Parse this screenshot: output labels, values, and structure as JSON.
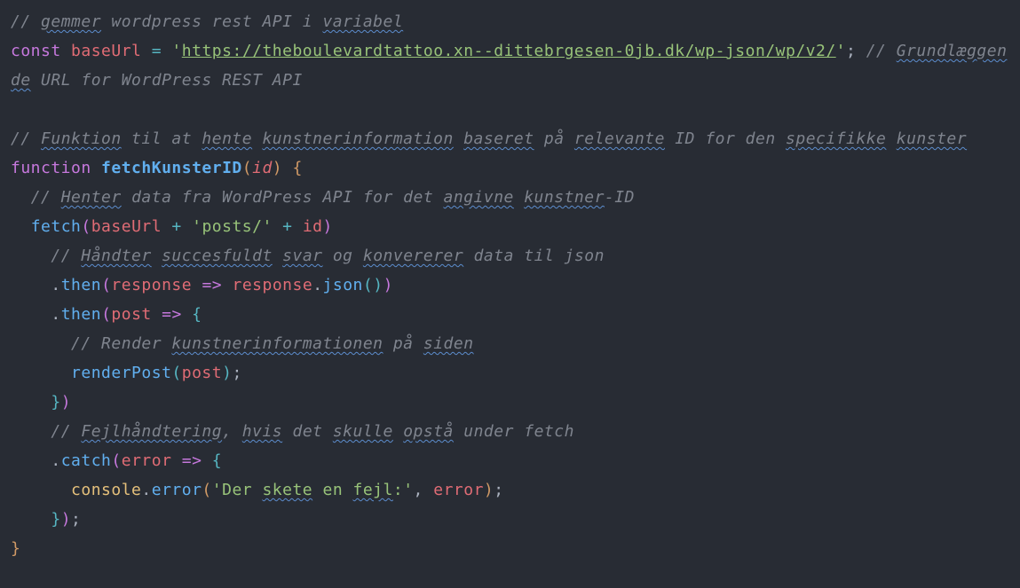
{
  "code": {
    "c1_gemmer": "gemmer",
    "c1_rest": " wordpress rest API i ",
    "c1_variabel": "variabel",
    "kw_const": "const",
    "var_baseUrl": "baseUrl",
    "op_eq": "=",
    "str_q1": "'",
    "url_text": "https://theboulevardtattoo.xn--dittebrgesen-0jb.dk/wp-json/wp/v2/",
    "str_q2": "'",
    "semi": ";",
    "c2_grund": "Grundlæggende",
    "c2_rest": " URL for WordPress REST API",
    "c3_funktion": "Funktion",
    "c3_til": " til at ",
    "c3_hente": "hente",
    "c3_sp": " ",
    "c3_kunst": "kunstnerinformation",
    "c3_sp2": " ",
    "c3_baseret": "baseret",
    "c3_pa": " på ",
    "c3_relevante": "relevante",
    "c3_idfor": " ID for den ",
    "c3_specifikke": "specifikke",
    "c3_sp3": " ",
    "c3_kunster": "kunster",
    "kw_function": "function",
    "fn_fetchKunsterID": "fetchKunsterID",
    "param_id": "id",
    "c4_henter": "Henter",
    "c4_rest1": " data fra WordPress API for det ",
    "c4_angivne": "angivne",
    "c4_sp": " ",
    "c4_kunstner": "kunstner",
    "c4_rest2": "-ID",
    "fn_fetch": "fetch",
    "var_baseUrl2": "baseUrl",
    "op_plus": "+",
    "str_posts": "'posts/'",
    "var_id2": "id",
    "c5_handter": "Håndter",
    "c5_sp": " ",
    "c5_succes": "succesfuldt",
    "c5_sp2": " ",
    "c5_svar": "svar",
    "c5_og": " og ",
    "c5_konv": "konvererer",
    "c5_rest": " data til json",
    "fn_then": "then",
    "var_response": "response",
    "arrow": "=>",
    "var_response2": "response",
    "fn_json": "json",
    "var_post": "post",
    "c6_render": " Render ",
    "c6_kunst": "kunstnerinformationen",
    "c6_pa": " på ",
    "c6_siden": "siden",
    "fn_renderPost": "renderPost",
    "var_post2": "post",
    "c7_fejl": "Fejlhåndtering",
    "c7_com": ", ",
    "c7_hvis": "hvis",
    "c7_det": " det ",
    "c7_skulle": "skulle",
    "c7_sp": " ",
    "c7_opsta": "opstå",
    "c7_rest": " under fetch",
    "fn_catch": "catch",
    "var_error": "error",
    "obj_console": "console",
    "fn_error": "error",
    "str_fejl_open": "'Der ",
    "str_skete": "skete",
    "str_en": " en ",
    "str_fejl_w": "fejl",
    "str_fejl_close": ":'",
    "comma": ",",
    "var_error2": "error",
    "brace_open": "{",
    "brace_close": "}",
    "paren_open": "(",
    "paren_close": ")",
    "dot": ".",
    "slashslash": "// "
  }
}
